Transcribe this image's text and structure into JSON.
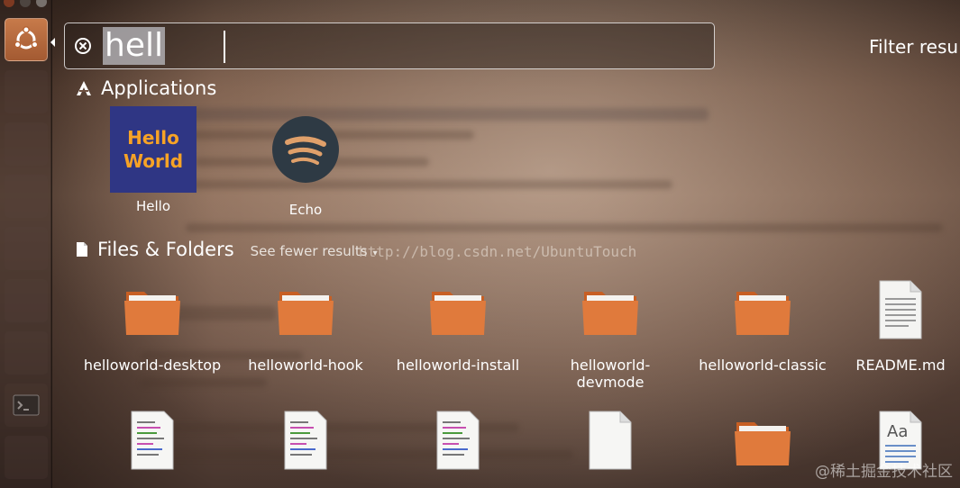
{
  "search": {
    "query": "hell"
  },
  "filter": {
    "label": "Filter results"
  },
  "applications": {
    "header": "Applications",
    "items": [
      {
        "label": "Hello",
        "icon": "hello-world-icon",
        "icon_text_line1": "Hello",
        "icon_text_line2": "World"
      },
      {
        "label": "Echo",
        "icon": "spotify-style-icon"
      }
    ]
  },
  "files": {
    "header": "Files & Folders",
    "see_fewer": "See fewer results",
    "row1": [
      {
        "label": "helloworld-desktop",
        "icon": "folder-icon"
      },
      {
        "label": "helloworld-hook",
        "icon": "folder-icon"
      },
      {
        "label": "helloworld-install",
        "icon": "folder-icon"
      },
      {
        "label": "helloworld-devmode",
        "icon": "folder-icon"
      },
      {
        "label": "helloworld-classic",
        "icon": "folder-icon"
      },
      {
        "label": "README.md",
        "icon": "text-document-icon"
      }
    ],
    "row2": [
      {
        "icon": "code-document-icon"
      },
      {
        "icon": "code-document-icon"
      },
      {
        "icon": "code-document-icon"
      },
      {
        "icon": "blank-document-icon"
      },
      {
        "icon": "folder-icon"
      },
      {
        "icon": "font-document-icon"
      }
    ]
  },
  "overlay": {
    "watermark": "http://blog.csdn.net/UbuntuTouch",
    "corner_mark": "@稀土掘金技术社区"
  },
  "colors": {
    "folder": "#e07a3c",
    "folder_dark": "#c75f24",
    "hello_bg": "#2f3684",
    "hello_text": "#f7a326",
    "echo_bg": "#2e3a44",
    "echo_waves": "#e0a06a"
  }
}
